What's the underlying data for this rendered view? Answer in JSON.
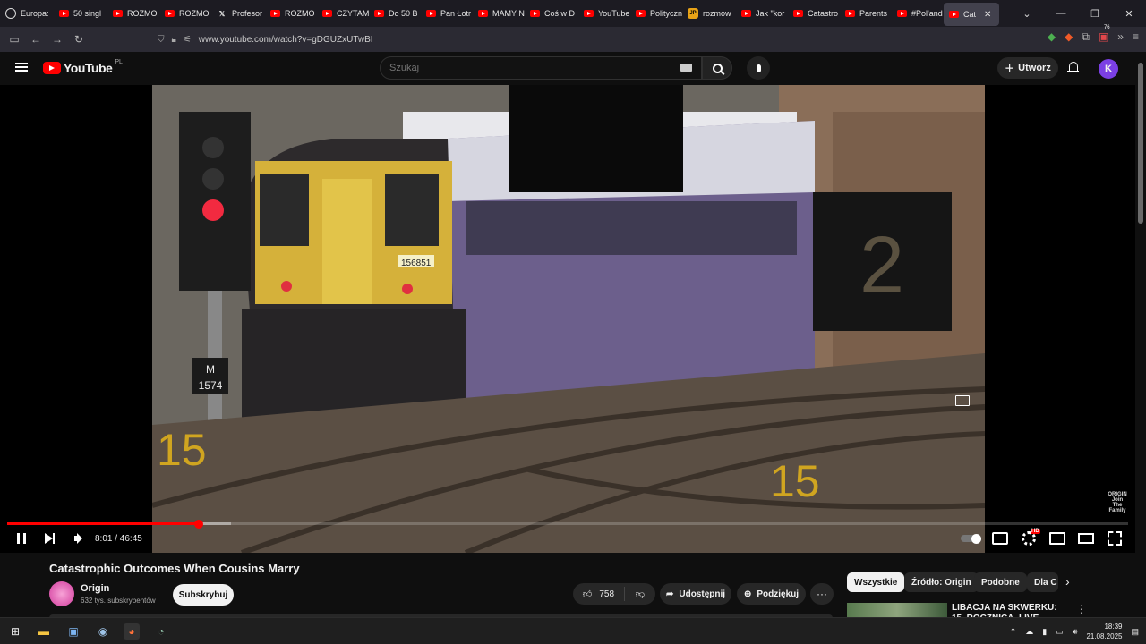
{
  "browser": {
    "tabs": [
      {
        "label": "Europa:",
        "icon": "globe-icon"
      },
      {
        "label": "50 singl",
        "icon": "youtube-icon"
      },
      {
        "label": "ROZMO",
        "icon": "youtube-icon"
      },
      {
        "label": "ROZMO",
        "icon": "youtube-icon"
      },
      {
        "label": "Profesor",
        "icon": "x-icon"
      },
      {
        "label": "ROZMO",
        "icon": "youtube-icon"
      },
      {
        "label": "CZYTAM",
        "icon": "youtube-icon"
      },
      {
        "label": "Do 50 B",
        "icon": "youtube-icon"
      },
      {
        "label": "Pan Łotr",
        "icon": "youtube-icon"
      },
      {
        "label": "MAMY N",
        "icon": "youtube-icon"
      },
      {
        "label": "Coś w D",
        "icon": "youtube-icon"
      },
      {
        "label": "YouTube",
        "icon": "youtube-icon"
      },
      {
        "label": "Polityczn",
        "icon": "youtube-icon"
      },
      {
        "label": "rozmow",
        "icon": "jp-icon"
      },
      {
        "label": "Jak \"kor",
        "icon": "youtube-icon"
      },
      {
        "label": "Catastro",
        "icon": "youtube-icon"
      },
      {
        "label": "Parents",
        "icon": "youtube-icon"
      },
      {
        "label": "#Pol'and",
        "icon": "youtube-icon"
      },
      {
        "label": "Cat",
        "icon": "youtube-icon",
        "active": true
      }
    ],
    "url": "www.youtube.com/watch?v=gDGUZxUTwBI",
    "extension_badge": "76"
  },
  "youtube": {
    "logo_text": "YouTube",
    "country_code": "PL",
    "search_placeholder": "Szukaj",
    "create_label": "Utwórz",
    "avatar_letter": "K"
  },
  "player": {
    "current_time": "8:01",
    "duration": "46:45",
    "time_display": "8:01 / 46:45",
    "progress_fraction": 0.171,
    "buffered_fraction": 0.2,
    "watermark": [
      "ORIGIN",
      "Join",
      "The",
      "Family"
    ],
    "hd_badge": "HD",
    "scene_labels": {
      "signal_plate": "M\n1574",
      "platform_sign": "2",
      "ground_number": "15",
      "train_number": "156851"
    }
  },
  "video": {
    "title": "Catastrophic Outcomes When Cousins Marry",
    "channel": "Origin",
    "subscribers": "632 tys. subskrybentów",
    "subscribe_label": "Subskrybuj",
    "likes": "758",
    "share_label": "Udostępnij",
    "thanks_label": "Podziękuj",
    "more_label": "···"
  },
  "chips": [
    "Wszystkie",
    "Źródło: Origin",
    "Podobne",
    "Dla C"
  ],
  "recommendation": {
    "title": "LIBACJA NA SKWERKU: 15. ROCZNICA. LIVE PROSTO Z"
  },
  "taskbar": {
    "time": "18:39",
    "date": "21.08.2025"
  }
}
